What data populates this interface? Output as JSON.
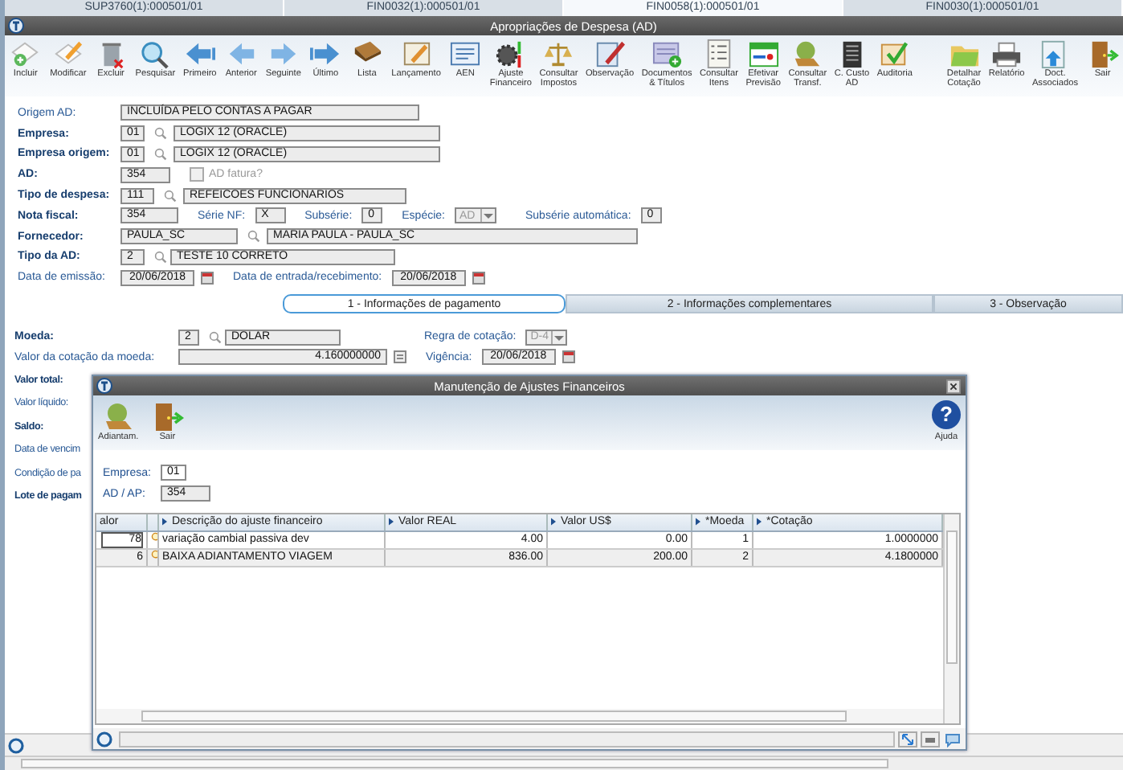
{
  "app_tabs": [
    {
      "label": "SUP3760(1):000501/01",
      "selected": false
    },
    {
      "label": "FIN0032(1):000501/01",
      "selected": false
    },
    {
      "label": "FIN0058(1):000501/01",
      "selected": true
    },
    {
      "label": "FIN0030(1):000501/01",
      "selected": false
    }
  ],
  "window": {
    "title": "Apropriações de Despesa (AD)"
  },
  "toolbar": [
    {
      "label": "Incluir"
    },
    {
      "label": "Modificar"
    },
    {
      "label": "Excluir"
    },
    {
      "label": "Pesquisar"
    },
    {
      "label": "Primeiro"
    },
    {
      "label": "Anterior"
    },
    {
      "label": "Seguinte"
    },
    {
      "label": "Último"
    },
    {
      "label": "Lista"
    },
    {
      "label": "Lançamento"
    },
    {
      "label": "AEN"
    },
    {
      "label": "Ajuste\nFinanceiro"
    },
    {
      "label": "Consultar\nImpostos"
    },
    {
      "label": "Observação"
    },
    {
      "label": "Documentos\n& Títulos"
    },
    {
      "label": "Consultar\nItens"
    },
    {
      "label": "Efetivar\nPrevisão"
    },
    {
      "label": "Consultar\nTransf."
    },
    {
      "label": "C. Custo\nAD"
    },
    {
      "label": "Auditoria"
    },
    {
      "label": "Detalhar\nCotação"
    },
    {
      "label": "Relatório"
    },
    {
      "label": "Doct.\nAssociados"
    },
    {
      "label": "Sair"
    }
  ],
  "form": {
    "origem": {
      "label": "Origem AD:",
      "required": false,
      "value": "INCLUÍDA PELO CONTAS A PAGAR"
    },
    "empresa": {
      "label": "Empresa:",
      "required": true,
      "code": "01",
      "description": "LOGIX 12 (ORACLE)"
    },
    "empresa_origem": {
      "label": "Empresa origem:",
      "required": true,
      "code": "01",
      "description": "LOGIX 12 (ORACLE)"
    },
    "ad": {
      "label": "AD:",
      "required": true,
      "value": "354",
      "fatura": {
        "label": "AD fatura?",
        "checked": false,
        "disabled": true
      }
    },
    "tipo_despesa": {
      "label": "Tipo de despesa:",
      "required": true,
      "code": "111",
      "description": "REFEICOES  FUNCIONARIOS"
    },
    "nota_fiscal": {
      "label": "Nota fiscal:",
      "required": true,
      "value": "354"
    },
    "serie": {
      "label": "Série NF:",
      "required": false,
      "value": "X"
    },
    "subserie": {
      "label": "Subsérie:",
      "required": false,
      "value": "0"
    },
    "especie": {
      "label": "Espécie:",
      "required": false,
      "value": "AD",
      "disabled": true
    },
    "subserie_auto": {
      "label": "Subsérie automática:",
      "required": false,
      "value": "0"
    },
    "fornecedor": {
      "label": "Fornecedor:",
      "required": true,
      "code": "PAULA_SC",
      "description": "MARIA PAULA - PAULA_SC"
    },
    "tipo_ad": {
      "label": "Tipo da AD:",
      "required": true,
      "code": "2",
      "description": "TESTE 10 CORRETO"
    },
    "data_emissao": {
      "label": "Data de emissão:",
      "required": false,
      "value": "20/06/2018"
    },
    "data_entrada": {
      "label": "Data de entrada/recebimento:",
      "required": false,
      "value": "20/06/2018"
    }
  },
  "tabs": [
    {
      "label": "1 - Informações de pagamento",
      "selected": true
    },
    {
      "label": "2 - Informações complementares",
      "selected": false
    },
    {
      "label": "3 - Observação",
      "selected": false
    }
  ],
  "payment": {
    "moeda": {
      "label": "Moeda:",
      "required": true,
      "code": "2",
      "description": "DOLAR"
    },
    "regra": {
      "label": "Regra de cotação:",
      "required": false,
      "value": "D-4",
      "disabled": true
    },
    "cotacao": {
      "label": "Valor da cotação da moeda:",
      "required": false,
      "value": "4.160000000"
    },
    "vigencia": {
      "label": "Vigência:",
      "required": false,
      "value": "20/06/2018"
    },
    "labels": [
      {
        "label": "Valor total:",
        "required": true
      },
      {
        "label": "Valor líquido:",
        "required": false
      },
      {
        "label": "Saldo:",
        "required": true
      },
      {
        "label": "Data de vencim",
        "required": false
      },
      {
        "label": "Condição de pa",
        "required": false
      },
      {
        "label": "Lote de pagam",
        "required": true
      }
    ]
  },
  "modal": {
    "title": "Manutenção de Ajustes Financeiros",
    "tools": [
      {
        "label": "Adiantam."
      },
      {
        "label": "Sair"
      }
    ],
    "help": {
      "symbol": "?",
      "label": "Ajuda"
    },
    "empresa": {
      "label": "Empresa:",
      "value": "01"
    },
    "ad_ap": {
      "label": "AD / AP:",
      "value": "354"
    },
    "grid": {
      "columns": [
        "alor",
        "Descrição do ajuste financeiro",
        "Valor REAL",
        "Valor US$",
        "*Moeda",
        "*Cotação"
      ],
      "rows": [
        [
          "78",
          "variação cambial passiva dev",
          "4.00",
          "0.00",
          "1",
          "1.0000000"
        ],
        [
          "6",
          "BAIXA ADIANTAMENTO VIAGEM",
          "836.00",
          "200.00",
          "2",
          "4.1800000"
        ]
      ]
    }
  }
}
